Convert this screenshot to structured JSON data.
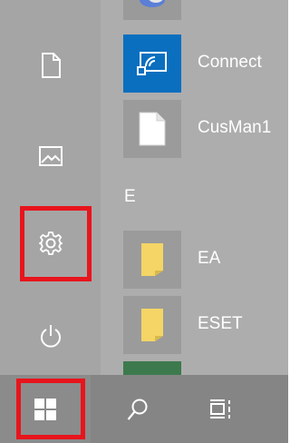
{
  "apps": {
    "connect": {
      "label": "Connect"
    },
    "cusman": {
      "label": "CusMan1"
    },
    "section_e": "E",
    "ea": {
      "label": "EA"
    },
    "eset": {
      "label": "ESET"
    }
  },
  "rail": {
    "items": [
      {
        "name": "documents",
        "icon": "document-icon"
      },
      {
        "name": "pictures",
        "icon": "picture-icon"
      },
      {
        "name": "settings",
        "icon": "gear-icon",
        "highlighted": true
      },
      {
        "name": "power",
        "icon": "power-icon"
      }
    ]
  },
  "taskbar": {
    "start": {
      "icon": "windows-logo-icon",
      "highlighted": true
    },
    "search": {
      "icon": "search-icon"
    },
    "task_view": {
      "icon": "task-view-icon"
    }
  },
  "colors": {
    "highlight": "#e8141c",
    "connect_tile": "#0a6fbf",
    "folder_tile": "#f4d565",
    "rail_bg": "#a5a5a5",
    "taskbar_bg": "#858585"
  }
}
